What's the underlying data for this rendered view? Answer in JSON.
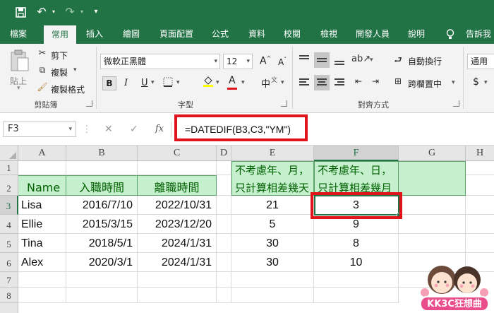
{
  "quick_access": {
    "save_icon": "save-icon",
    "undo_icon": "undo-icon",
    "redo_icon": "redo-icon",
    "customize_icon": "customize-icon"
  },
  "tabs": [
    "檔案",
    "常用",
    "插入",
    "繪圖",
    "頁面配置",
    "公式",
    "資料",
    "校閱",
    "檢視",
    "開發人員",
    "說明",
    "告訴我"
  ],
  "active_tab": "常用",
  "ribbon": {
    "clipboard": {
      "paste": "貼上",
      "cut": "剪下",
      "copy": "複製",
      "format_painter": "複製格式",
      "label": "剪貼簿"
    },
    "font": {
      "name": "微軟正黑體",
      "size": "12",
      "grow": "A",
      "shrink": "A",
      "bold": "B",
      "italic": "I",
      "underline": "U",
      "font_color": "A",
      "phonetic": "中",
      "label": "字型"
    },
    "alignment": {
      "wrap_text": "自動換行",
      "merge_center": "跨欄置中",
      "label": "對齊方式"
    },
    "number": {
      "format": "通用格",
      "currency": "$"
    }
  },
  "formula_bar": {
    "name_box": "F3",
    "cancel": "✕",
    "enter": "✓",
    "fx": "fx",
    "formula": "=DATEDIF(B3,C3,\"YM\")"
  },
  "sheet": {
    "columns": [
      "A",
      "B",
      "C",
      "D",
      "E",
      "F",
      "G",
      "H"
    ],
    "rows": [
      "1",
      "2",
      "3",
      "4",
      "5",
      "6",
      "7",
      "8"
    ],
    "headers": {
      "A": "Name",
      "B": "入職時間",
      "C": "離職時間",
      "E": "不考慮年、月，只計算相差幾天",
      "F": "不考慮年、日，只計算相差幾月"
    },
    "data": [
      {
        "name": "Lisa",
        "start": "2016/7/10",
        "end": "2022/10/31",
        "days": "21",
        "months": "3"
      },
      {
        "name": "Ellie",
        "start": "2015/3/15",
        "end": "2023/12/20",
        "days": "5",
        "months": "9"
      },
      {
        "name": "Tina",
        "start": "2018/5/1",
        "end": "2024/1/31",
        "days": "30",
        "months": "8"
      },
      {
        "name": "Alex",
        "start": "2020/3/1",
        "end": "2024/1/31",
        "days": "30",
        "months": "10"
      }
    ],
    "selected_cell": "F3"
  },
  "watermark": "KK3C狂想曲",
  "colors": {
    "excel_green": "#217346",
    "header_fill": "#c6efce",
    "header_text": "#006100",
    "highlight_red": "#e0141a"
  }
}
